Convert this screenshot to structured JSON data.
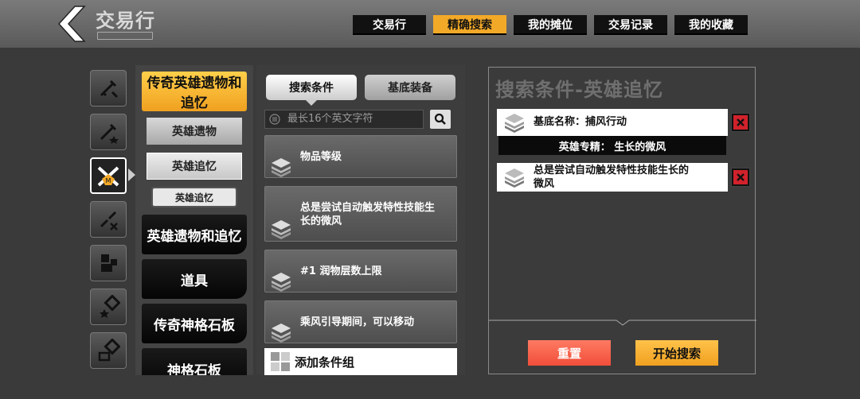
{
  "header": {
    "title": "交易行",
    "tabs": [
      {
        "label": "交易行",
        "active": false
      },
      {
        "label": "精确搜索",
        "active": true
      },
      {
        "label": "我的摊位",
        "active": false
      },
      {
        "label": "交易记录",
        "active": false
      },
      {
        "label": "我的收藏",
        "active": false
      }
    ]
  },
  "colors": {
    "accent": "#f3a928",
    "delete": "#d1222b",
    "reset": "#f04e3a"
  },
  "icon_column": {
    "icons": [
      "sword-slash-icon",
      "sword-star-icon",
      "hero-memory-icon",
      "sword-broken-icon",
      "puzzle-icon",
      "gear-star-icon",
      "gear-map-icon"
    ],
    "active_index": 2
  },
  "categories": {
    "main_selected": "传奇英雄遗物和追忆",
    "subs": [
      "英雄遗物",
      "英雄追忆"
    ],
    "subsub": "英雄追忆",
    "others": [
      "英雄遗物和追忆",
      "道具",
      "传奇神格石板",
      "神格石板"
    ]
  },
  "conditions": {
    "mode_active": "搜索条件",
    "mode_inactive": "基底装备",
    "search_placeholder": "最长16个英文字符",
    "items": [
      "物品等级",
      "总是尝试自动触发特性技能生长的微风",
      "#1 润物层数上限",
      "乘风引导期间，可以移动"
    ],
    "add_group_label": "添加条件组"
  },
  "search_panel": {
    "title": "搜索条件-英雄追忆",
    "base_name": "基底名称：捕风行动",
    "hero_specialty": "英雄专精： 生长的微风",
    "criteria_2": "总是尝试自动触发特性技能生长的微风",
    "reset_label": "重置",
    "start_label": "开始搜索"
  }
}
